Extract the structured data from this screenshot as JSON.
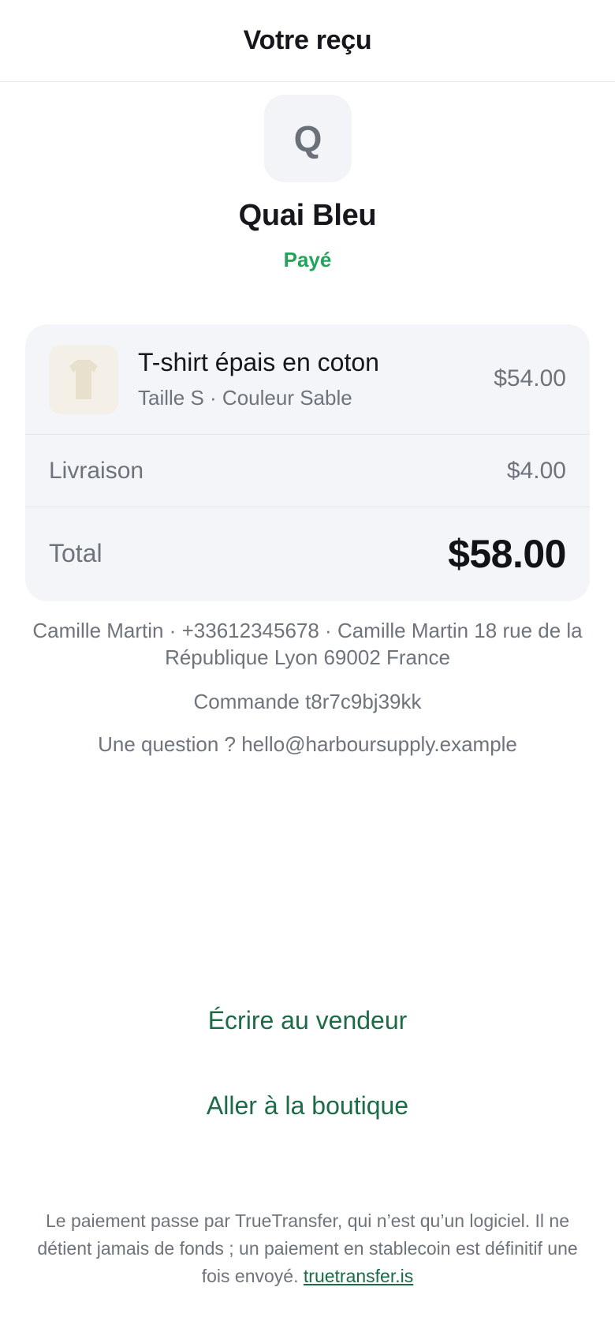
{
  "header": {
    "title": "Votre reçu"
  },
  "merchant": {
    "initial": "Q",
    "name": "Quai Bleu",
    "status": "Payé",
    "status_color": "#22a55a"
  },
  "item": {
    "icon": "t-shirt-icon",
    "name": "T-shirt épais en coton",
    "variant": "Taille S · Couleur Sable",
    "price": "$54.00"
  },
  "shipping": {
    "label": "Livraison",
    "price": "$4.00"
  },
  "total": {
    "label": "Total",
    "price": "$58.00"
  },
  "customer": {
    "details": "Camille Martin · +33612345678 · Camille Martin 18 rue de la République Lyon 69002 France"
  },
  "order": {
    "text": "Commande t8r7c9bj39kk"
  },
  "support": {
    "text": "Une question ? hello@harboursupply.example"
  },
  "actions": {
    "write_label": "Écrire au vendeur",
    "shop_label": "Aller à la boutique",
    "accent_color": "#1b6b45"
  },
  "footer": {
    "disclaimer": "Le paiement passe par TrueTransfer, qui n’est qu’un logiciel. Il ne détient jamais de fonds ; un paiement en stablecoin est définitif une fois envoyé.",
    "link_text": "truetransfer.is"
  }
}
